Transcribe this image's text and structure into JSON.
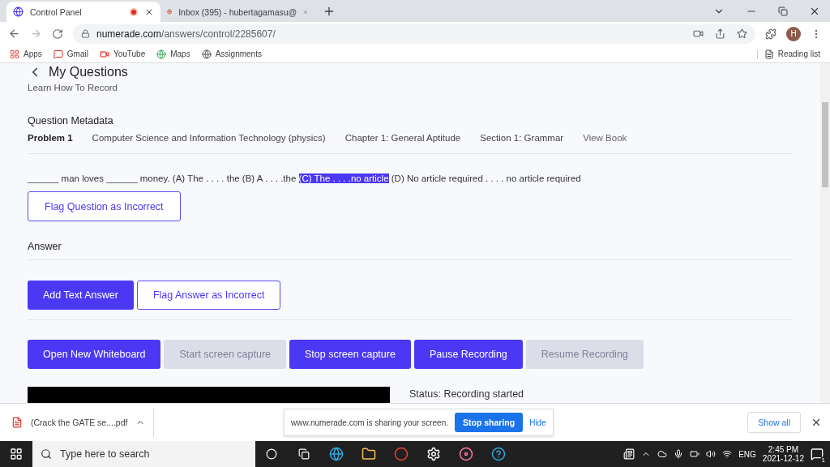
{
  "browser": {
    "tabs": [
      {
        "title": "Control Panel",
        "selected": true,
        "recording": true
      },
      {
        "title": "Inbox (395) - hubertagamasu@",
        "selected": false,
        "recording": false
      }
    ],
    "url_host": "numerade.com",
    "url_path": "/answers/control/2285607/",
    "profile_initial": "H",
    "bookmarks": [
      "Apps",
      "Gmail",
      "YouTube",
      "Maps",
      "Assignments"
    ],
    "reading_list": "Reading list"
  },
  "page": {
    "back_title": "My Questions",
    "subtitle": "Learn How To Record",
    "metadata_heading": "Question Metadata",
    "metadata": [
      {
        "text": "Problem 1",
        "kind": "strong"
      },
      {
        "text": "Computer Science and Information Technology (physics)",
        "kind": "plain"
      },
      {
        "text": "Chapter 1: General Aptitude",
        "kind": "plain"
      },
      {
        "text": "Section 1: Grammar",
        "kind": "plain"
      },
      {
        "text": "View Book",
        "kind": "link"
      }
    ],
    "question": {
      "before": "______ man loves ______ money. (A) The . . . . the (B) A . . . .the ",
      "selection": "(C) The . . . .no article",
      "after": " (D) No article required . . . . no article required"
    },
    "flag_question": "Flag Question as Incorrect",
    "answer_heading": "Answer",
    "answer_buttons": [
      {
        "label": "Add Text Answer",
        "kind": "primary"
      },
      {
        "label": "Flag Answer as Incorrect",
        "kind": "outline"
      }
    ],
    "record_buttons": [
      {
        "label": "Open New Whiteboard",
        "disabled": false
      },
      {
        "label": "Start screen capture",
        "disabled": true
      },
      {
        "label": "Stop screen capture",
        "disabled": false
      },
      {
        "label": "Pause Recording",
        "disabled": false
      },
      {
        "label": "Resume Recording",
        "disabled": true
      }
    ],
    "status": "Status: Recording started"
  },
  "downloads": {
    "file": "(Crack the GATE se....pdf",
    "sharing_message": "www.numerade.com is sharing your screen.",
    "stop_sharing": "Stop sharing",
    "hide": "Hide",
    "show_all": "Show all"
  },
  "taskbar": {
    "search_placeholder": "Type here to search",
    "language": "ENG",
    "time": "2:45 PM",
    "date": "2021-12-12",
    "notifications": "1"
  }
}
